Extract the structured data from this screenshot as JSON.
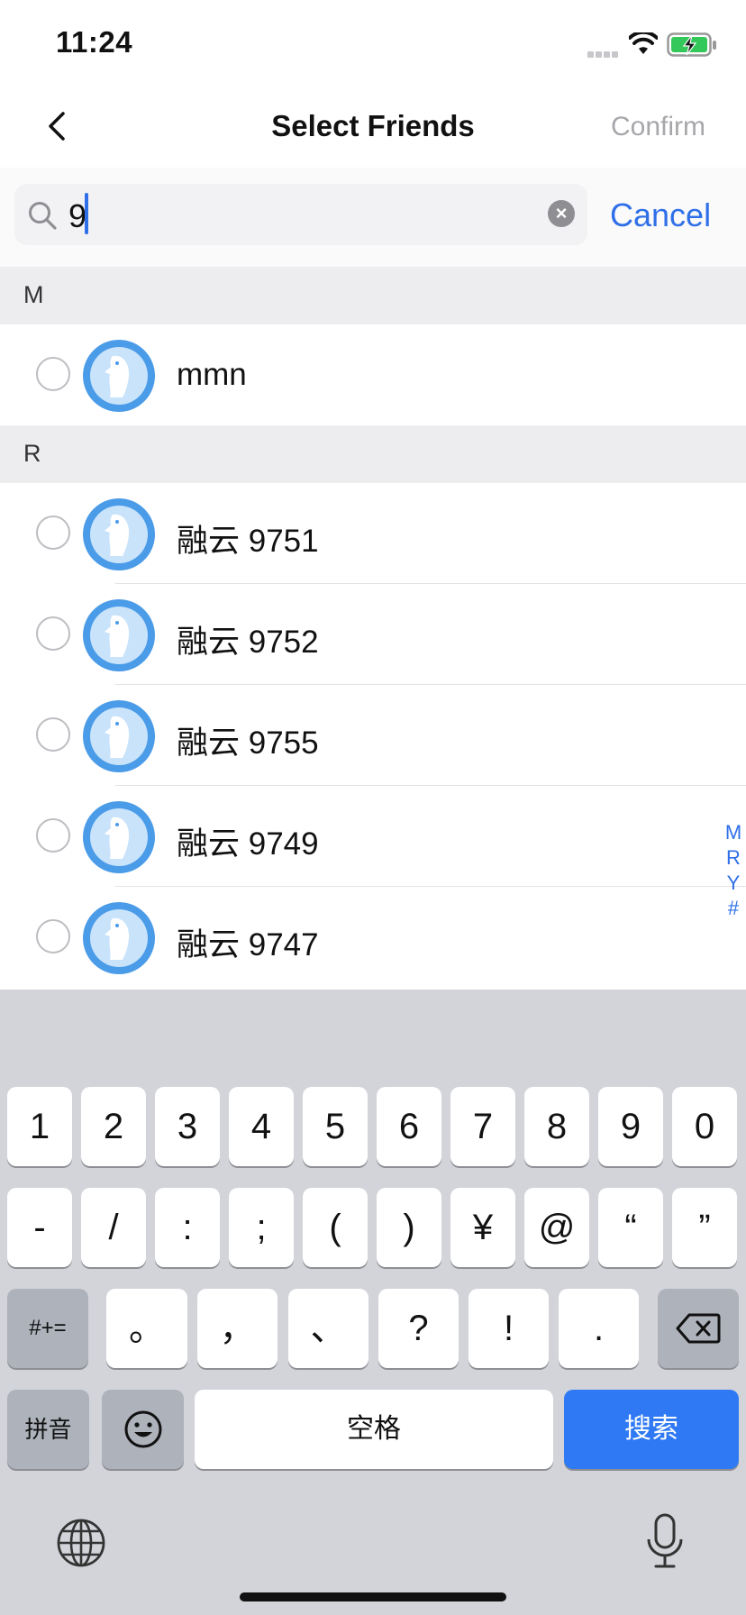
{
  "status_bar": {
    "time": "11:24"
  },
  "nav": {
    "title": "Select Friends",
    "confirm_label": "Confirm"
  },
  "search": {
    "value": "9",
    "cancel_label": "Cancel"
  },
  "sections": [
    {
      "letter": "M",
      "contacts": [
        {
          "name": "mmn"
        }
      ]
    },
    {
      "letter": "R",
      "contacts": [
        {
          "name": "融云 9751"
        },
        {
          "name": "融云 9752"
        },
        {
          "name": "融云 9755"
        },
        {
          "name": "融云 9749"
        },
        {
          "name": "融云 9747"
        }
      ]
    }
  ],
  "index_letters": [
    "M",
    "R",
    "Y",
    "#"
  ],
  "keyboard": {
    "row1": [
      "1",
      "2",
      "3",
      "4",
      "5",
      "6",
      "7",
      "8",
      "9",
      "0"
    ],
    "row2": [
      "-",
      "/",
      ":",
      ";",
      "(",
      ")",
      "¥",
      "@",
      "“",
      "”"
    ],
    "row3": [
      "。",
      "，",
      "、",
      "?",
      "!",
      "."
    ],
    "symbols_label": "#+=",
    "pinyin_label": "拼音",
    "space_label": "空格",
    "search_label": "搜索"
  },
  "colors": {
    "accent": "#2f6fe8",
    "avatar": "#4a9be8",
    "section_bg": "#ededf0",
    "keyboard_bg": "#d2d4da"
  }
}
